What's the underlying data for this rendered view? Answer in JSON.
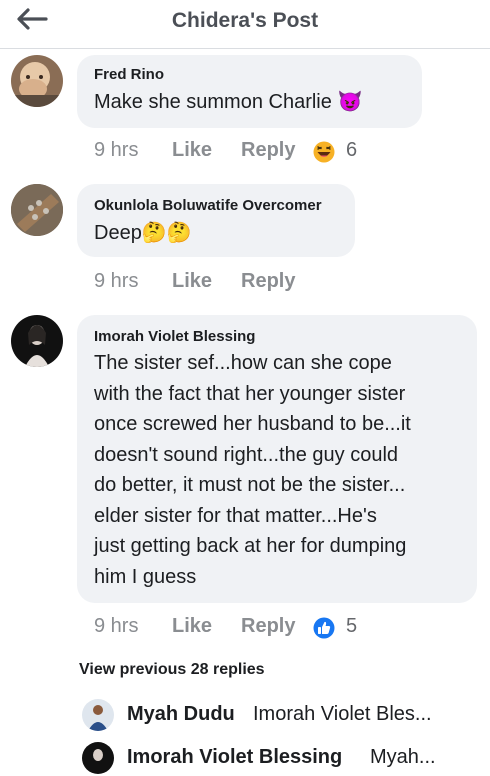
{
  "header": {
    "title": "Chidera's Post"
  },
  "comments": [
    {
      "author": "Fred Rino",
      "text": "Make she summon Charlie",
      "emoji": "😈",
      "time": "9 hrs",
      "like_label": "Like",
      "reply_label": "Reply",
      "reaction_icon": "laughing-emoji",
      "reaction_count": "6"
    },
    {
      "author": "Okunlola Boluwatife Overcomer",
      "text": "Deep",
      "emoji": "🤔🤔",
      "time": "9 hrs",
      "like_label": "Like",
      "reply_label": "Reply"
    },
    {
      "author": "Imorah Violet Blessing",
      "lines": [
        "The sister sef...how can she cope",
        "with the fact that her younger sister",
        "once screwed her husband to be...it",
        "doesn't sound right...the guy could",
        "do better, it must not be the sister...",
        "elder sister for that matter...He's",
        "just getting back at her for dumping",
        "him I guess"
      ],
      "time": "9 hrs",
      "like_label": "Like",
      "reply_label": "Reply",
      "reaction_icon": "thumbs-up",
      "reaction_count": "5"
    }
  ],
  "view_previous": "View previous 28 replies",
  "replies": [
    {
      "name": "Myah Dudu",
      "text": "Imorah Violet Bles..."
    },
    {
      "name": "Imorah Violet Blessing",
      "text": "Myah..."
    }
  ],
  "colors": {
    "bubble": "#f0f2f5",
    "meta": "#8a8d91",
    "like_blue": "#1877f2",
    "haha_yellow": "#f7b125"
  }
}
